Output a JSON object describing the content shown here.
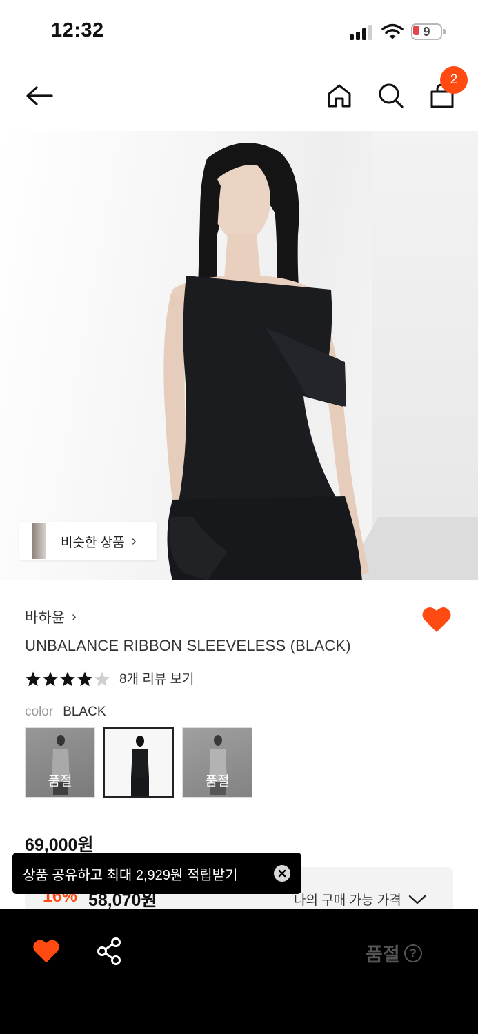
{
  "status_bar": {
    "time": "12:32",
    "battery_level": "9"
  },
  "header": {
    "back_icon": "arrow-left-icon",
    "home_icon": "home-icon",
    "search_icon": "search-icon",
    "cart_icon": "shopping-bag-icon",
    "cart_badge": "2",
    "accent_color": "#ff4b12"
  },
  "hero": {
    "similar_label": "비슷한 상품"
  },
  "product": {
    "brand": "바하윤",
    "name": "UNBALANCE RIBBON SLEEVELESS (BLACK)",
    "rating": 4,
    "rating_max": 5,
    "review_link": "8개 리뷰 보기",
    "color_label": "color",
    "color_value": "BLACK",
    "swatches": [
      {
        "sold_out": true,
        "label": "품절"
      },
      {
        "sold_out": false,
        "selected": true,
        "label": ""
      },
      {
        "sold_out": true,
        "label": "품절"
      }
    ],
    "original_price": "69,000원",
    "discount_rate": "16%",
    "discount_price": "58,070원",
    "my_price_label": "나의 구매 가능 가격"
  },
  "toast": {
    "text": "상품 공유하고 최대 2,929원 적립받기"
  },
  "bottom_bar": {
    "heart_icon": "heart-icon",
    "share_icon": "share-icon",
    "status_label": "품절",
    "help_icon": "question-circle-icon"
  }
}
